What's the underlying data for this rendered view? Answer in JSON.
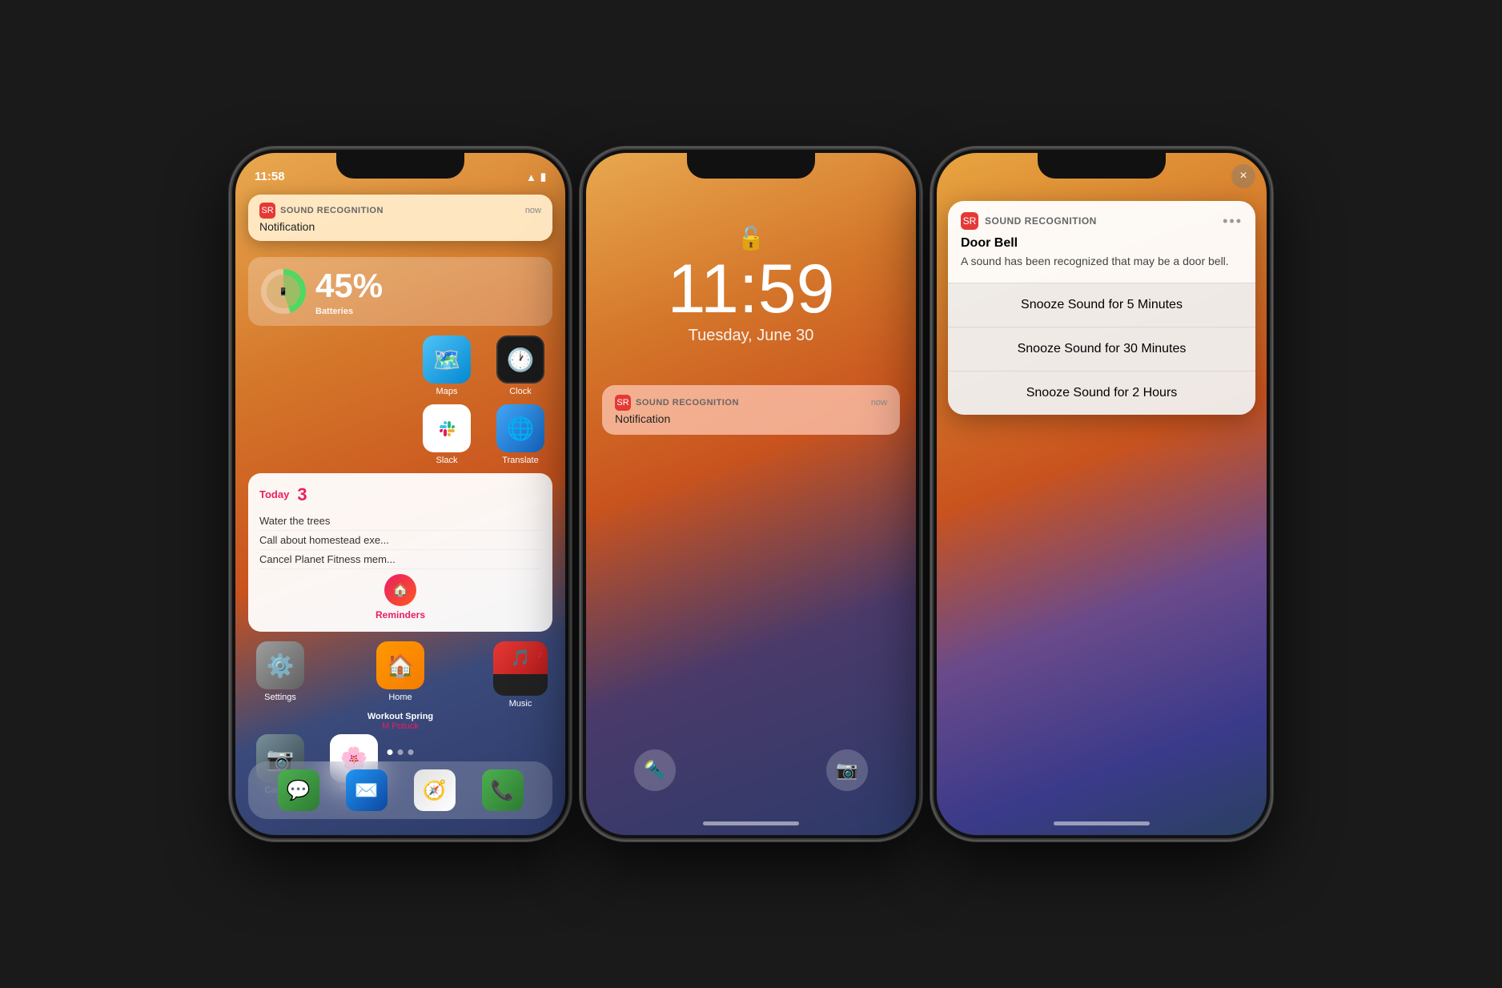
{
  "phone1": {
    "statusBar": {
      "time": "11:58",
      "icons": [
        "wifi",
        "battery"
      ]
    },
    "notification": {
      "appName": "SOUND RECOGNITION",
      "time": "now",
      "body": "Notification",
      "iconLabel": "SR"
    },
    "batteries": {
      "percent": "45%",
      "label": "Batteries"
    },
    "appRow1": [
      {
        "label": "Maps",
        "icon": "🗺️",
        "class": "maps-icon"
      },
      {
        "label": "Clock",
        "icon": "🕐",
        "class": "clock-icon"
      }
    ],
    "appRow2": [
      {
        "label": "Slack",
        "icon": "💬",
        "class": "slack-icon"
      },
      {
        "label": "Translate",
        "icon": "🌐",
        "class": "translate-icon"
      }
    ],
    "reminders": {
      "dateLabel": "Today",
      "count": "3",
      "items": [
        "Water the trees",
        "Call about homestead exe...",
        "Cancel Planet Fitness mem..."
      ],
      "sectionLabel": "Reminders"
    },
    "apps2": [
      {
        "label": "Settings",
        "class": "settings-icon"
      },
      {
        "label": "Home",
        "class": "home-app-icon"
      },
      {
        "label": "Music",
        "class": "music-card"
      }
    ],
    "apps3": [
      {
        "label": "Camera",
        "class": "camera-icon"
      },
      {
        "label": "Photos",
        "class": "photos-icon"
      }
    ],
    "music": {
      "title": "Workout Spring",
      "artist": "M Potuck"
    },
    "dock": [
      "Messages",
      "Mail",
      "Safari",
      "Phone"
    ]
  },
  "phone2": {
    "statusBar": {
      "icons": [
        "wifi",
        "battery"
      ]
    },
    "time": "11:59",
    "date": "Tuesday, June 30",
    "notification": {
      "appName": "SOUND RECOGNITION",
      "time": "now",
      "body": "Notification",
      "iconLabel": "SR"
    }
  },
  "phone3": {
    "notification": {
      "appName": "SOUND RECOGNITION",
      "dotsLabel": "•••",
      "title": "Door Bell",
      "description": "A sound has been recognized that may be a door bell.",
      "iconLabel": "SR"
    },
    "snoozeOptions": [
      "Snooze Sound for 5 Minutes",
      "Snooze Sound for 30 Minutes",
      "Snooze Sound for 2 Hours"
    ],
    "closeButton": "×"
  }
}
